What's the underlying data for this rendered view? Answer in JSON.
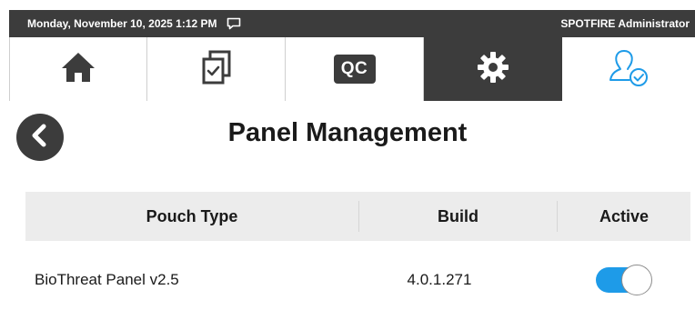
{
  "status_bar": {
    "datetime": "Monday, November 10, 2025 1:12 PM",
    "message_icon": "chat-bubble-icon",
    "user": "SPOTFIRE Administrator"
  },
  "nav": {
    "tabs": [
      {
        "name": "home",
        "icon": "home-icon",
        "active": false
      },
      {
        "name": "runs",
        "icon": "checklist-icon",
        "active": false
      },
      {
        "name": "qc",
        "label": "QC",
        "active": false
      },
      {
        "name": "settings",
        "icon": "gear-icon",
        "active": true
      },
      {
        "name": "user",
        "icon": "user-check-icon",
        "active": false
      }
    ]
  },
  "page": {
    "title": "Panel Management"
  },
  "table": {
    "headers": [
      "Pouch Type",
      "Build",
      "Active"
    ],
    "rows": [
      {
        "pouch_type": "BioThreat Panel v2.5",
        "build": "4.0.1.271",
        "active": true
      }
    ]
  },
  "colors": {
    "bar": "#3c3c3c",
    "accent": "#1e9be8",
    "header_bg": "#ececec"
  }
}
